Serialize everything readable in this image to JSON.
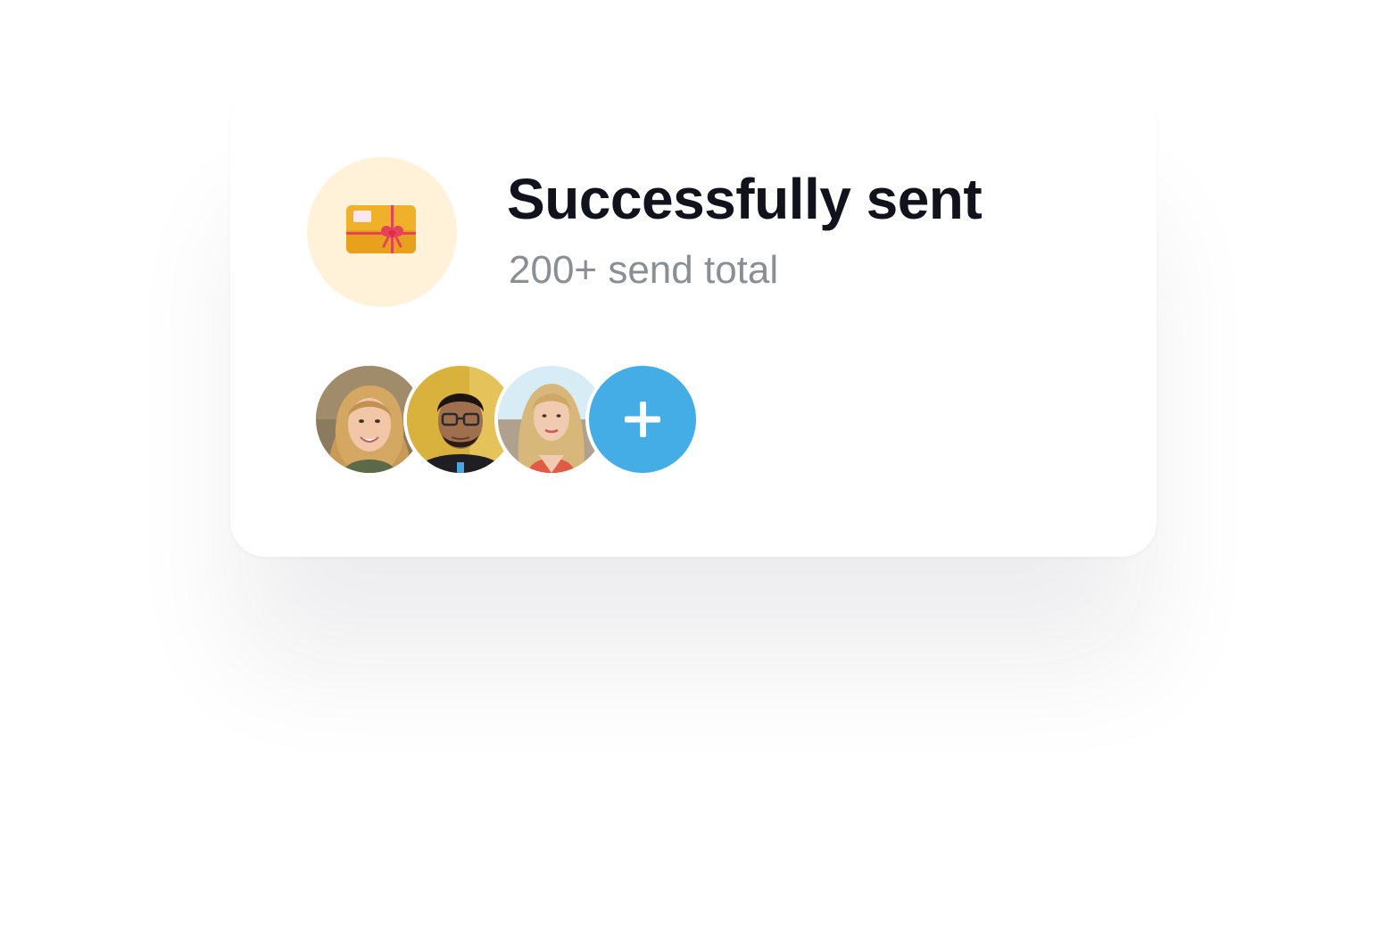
{
  "card": {
    "title": "Successfully sent",
    "subtitle": "200+ send total",
    "icon": "gift-card-icon",
    "colors": {
      "icon_bg": "#fff2d8",
      "add_button": "#45ade6",
      "title": "#12121c",
      "subtitle": "#8c8e96"
    }
  },
  "recipients": {
    "avatars": [
      {
        "name": "avatar-1"
      },
      {
        "name": "avatar-2"
      },
      {
        "name": "avatar-3"
      }
    ],
    "add_icon": "plus-icon"
  }
}
